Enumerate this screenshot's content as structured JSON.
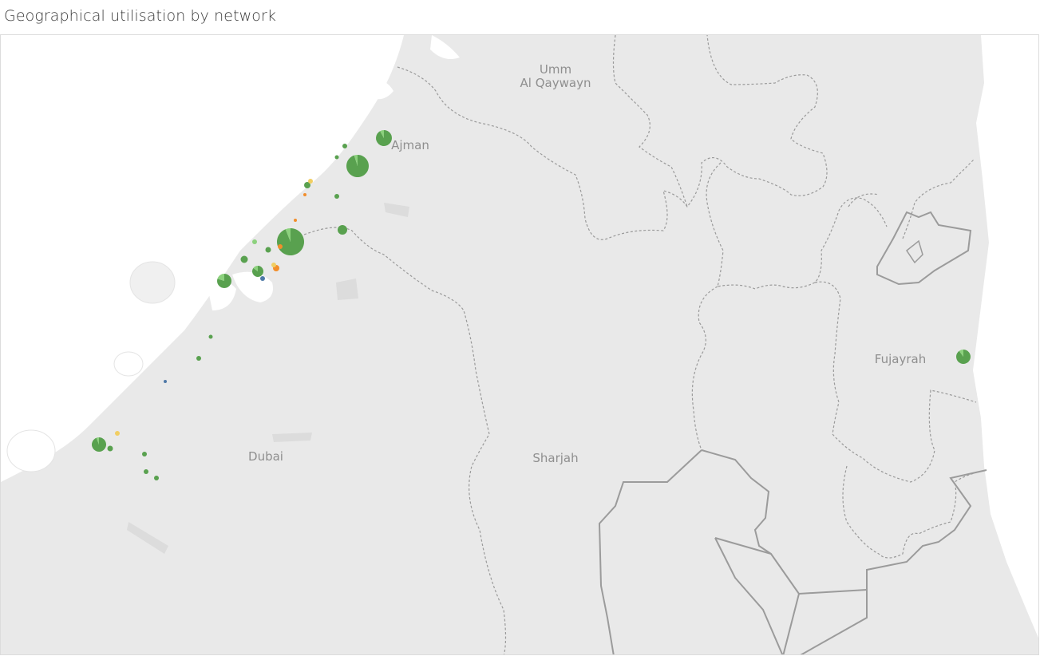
{
  "title": "Geographical utilisation by network",
  "labels": {
    "umm_line1": "Umm",
    "umm_line2": "Al Qaywayn",
    "ajman": "Ajman",
    "fujayrah": "Fujayrah",
    "dubai": "Dubai",
    "sharjah": "Sharjah"
  },
  "colors": {
    "land": "#e9e9e9",
    "water": "#ffffff",
    "green": "#59a14f",
    "light_green": "#8cd17d",
    "yellow": "#f1ce63",
    "orange": "#f28e2b",
    "red": "#e15759",
    "blue": "#4e79a7"
  },
  "chart_data": {
    "type": "map",
    "marks": [
      {
        "id": "ajman-1",
        "shares": [
          0.92,
          0.08
        ]
      },
      {
        "id": "ajman-2",
        "shares": [
          0.95,
          0.05
        ]
      },
      {
        "id": "sharjah-main",
        "shares": [
          0.94,
          0.06
        ]
      },
      {
        "id": "deira-1",
        "shares": [
          0.85,
          0.15
        ]
      },
      {
        "id": "deira-2",
        "shares": [
          0.8,
          0.2
        ]
      },
      {
        "id": "marina-1",
        "shares": [
          0.94,
          0.06
        ]
      },
      {
        "id": "fujayrah-1",
        "shares": [
          0.9,
          0.1
        ]
      }
    ]
  }
}
